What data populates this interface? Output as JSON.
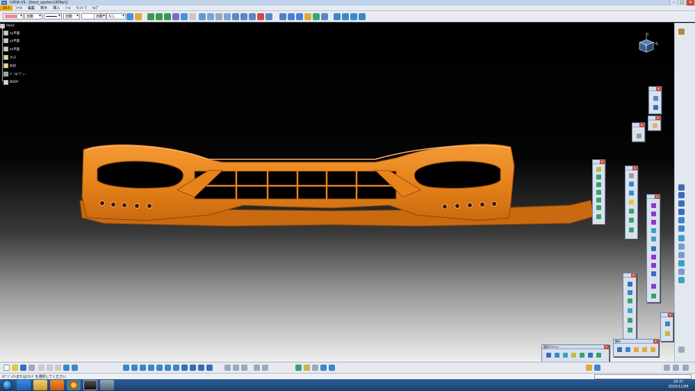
{
  "window": {
    "title": "CATIA V5 - [front_spoiler.CATPart]",
    "controls": {
      "minimize": "–",
      "maximize": "□",
      "close": "✕"
    }
  },
  "menu": {
    "items": [
      "ｽﾀｰﾄ",
      "ﾌｧｲﾙ",
      "編集",
      "表示",
      "挿入",
      "ﾂｰﾙ",
      "ｳｨﾝﾄﾞｳ",
      "ﾍﾙﾌﾟ"
    ],
    "active_index": 0
  },
  "format_toolbar": {
    "color_swatch": "#f28b8b",
    "dropdowns": [
      "自動",
      "自動",
      "自動",
      "なし"
    ]
  },
  "tree": {
    "root": "Part2",
    "items": [
      "xy平面",
      "yz平面",
      "zx平面",
      "ｽｹｯﾁ",
      "形状",
      "ﾊﾟｰﾂﾎﾞﾃﾞｨｰ",
      "BODY"
    ]
  },
  "compass": {
    "x_label": "x",
    "y_label": "y",
    "z_label": "z"
  },
  "palettes": [
    {
      "name": "palette-a",
      "title": ""
    },
    {
      "name": "palette-b",
      "title": ""
    },
    {
      "name": "palette-c",
      "title": ""
    },
    {
      "name": "palette-d",
      "title": ""
    },
    {
      "name": "palette-e",
      "title": ""
    },
    {
      "name": "palette-f",
      "title": ""
    },
    {
      "name": "palette-g",
      "title": ""
    },
    {
      "name": "palette-h",
      "title": "解析"
    },
    {
      "name": "palette-i",
      "title": "図形ｸﾘｴｲｼｮﾝ"
    }
  ],
  "status": {
    "message": "ｵﾌﾞｼﾞｪｸﾄまたはｺﾏﾝﾄﾞを選択してください"
  },
  "clock": {
    "time": "16:37",
    "date": "2015/11/08"
  },
  "colors": {
    "part": "#e8831a",
    "part_shadow": "#a8520c",
    "accent": "#f0a500"
  }
}
